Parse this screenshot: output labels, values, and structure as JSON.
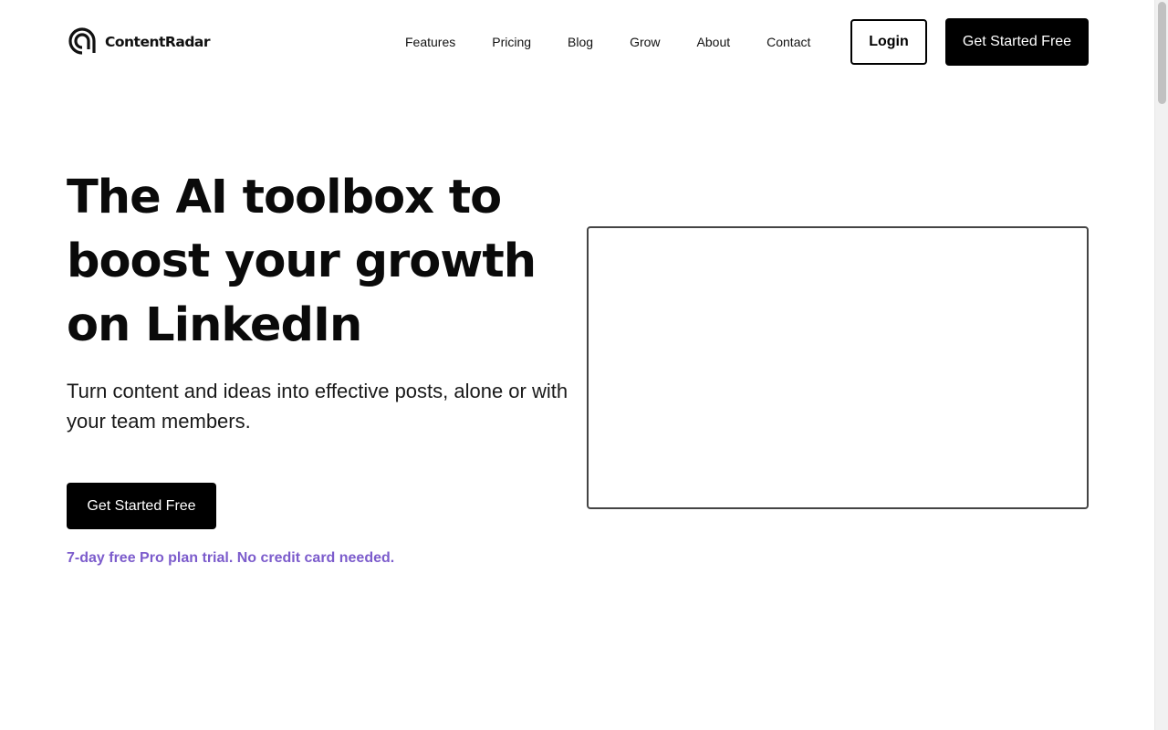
{
  "brand": {
    "name": "ContentRadar",
    "logo_icon": "radar-logo-icon"
  },
  "nav": {
    "items": [
      {
        "label": "Features"
      },
      {
        "label": "Pricing"
      },
      {
        "label": "Blog"
      },
      {
        "label": "Grow"
      },
      {
        "label": "About"
      },
      {
        "label": "Contact"
      }
    ],
    "login_label": "Login",
    "cta_label": "Get Started Free"
  },
  "hero": {
    "title": "The AI toolbox to boost your growth on LinkedIn",
    "subtitle": "Turn content and ideas into effective posts, alone or with your team members.",
    "cta_label": "Get Started Free",
    "trial_note": "7-day free Pro plan trial. No credit card needed."
  },
  "colors": {
    "primary": "#000000",
    "background": "#ffffff",
    "accent": "#7c5ccc"
  }
}
